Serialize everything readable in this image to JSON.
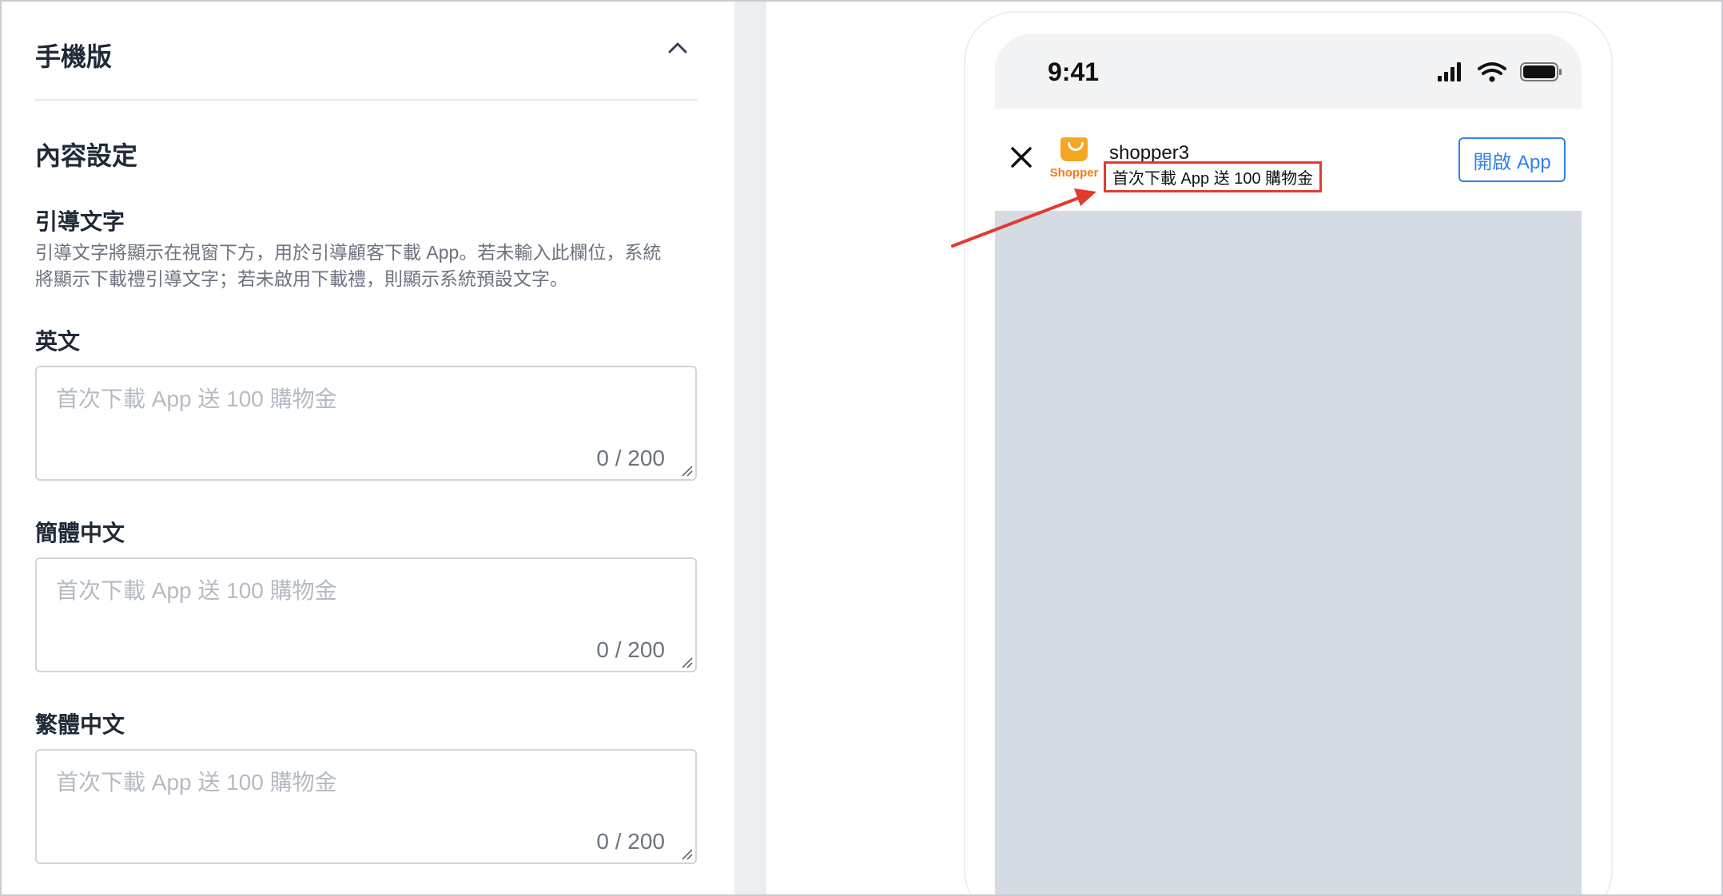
{
  "panel": {
    "section_title": "手機版",
    "content_title": "內容設定",
    "guide_title": "引導文字",
    "guide_desc_line1": "引導文字將顯示在視窗下方，用於引導顧客下載 App。若未輸入此欄位，系統",
    "guide_desc_line2": "將顯示下載禮引導文字；若未啟用下載禮，則顯示系統預設文字。",
    "fields": [
      {
        "label": "英文",
        "placeholder": "首次下載 App 送 100 購物金",
        "value": "",
        "counter": "0 / 200"
      },
      {
        "label": "簡體中文",
        "placeholder": "首次下載 App 送 100 購物金",
        "value": "",
        "counter": "0 / 200"
      },
      {
        "label": "繁體中文",
        "placeholder": "首次下載 App 送 100 購物金",
        "value": "",
        "counter": "0 / 200"
      }
    ]
  },
  "preview": {
    "status_time": "9:41",
    "app_logo_text": "Shopper",
    "app_name": "shopper3",
    "app_tagline": "首次下載 App 送 100 購物金",
    "open_app_label": "開啟 App"
  },
  "colors": {
    "accent_blue": "#2f80ed",
    "highlight_red": "#e23b2e",
    "logo_orange": "#f5a623",
    "preview_bg": "#d5dbe2"
  },
  "icons": [
    "chevron-up-icon",
    "close-icon",
    "signal-icon",
    "wifi-icon",
    "battery-icon",
    "shopper-bag-icon",
    "annotation-arrow",
    "resize-grip-icon"
  ]
}
